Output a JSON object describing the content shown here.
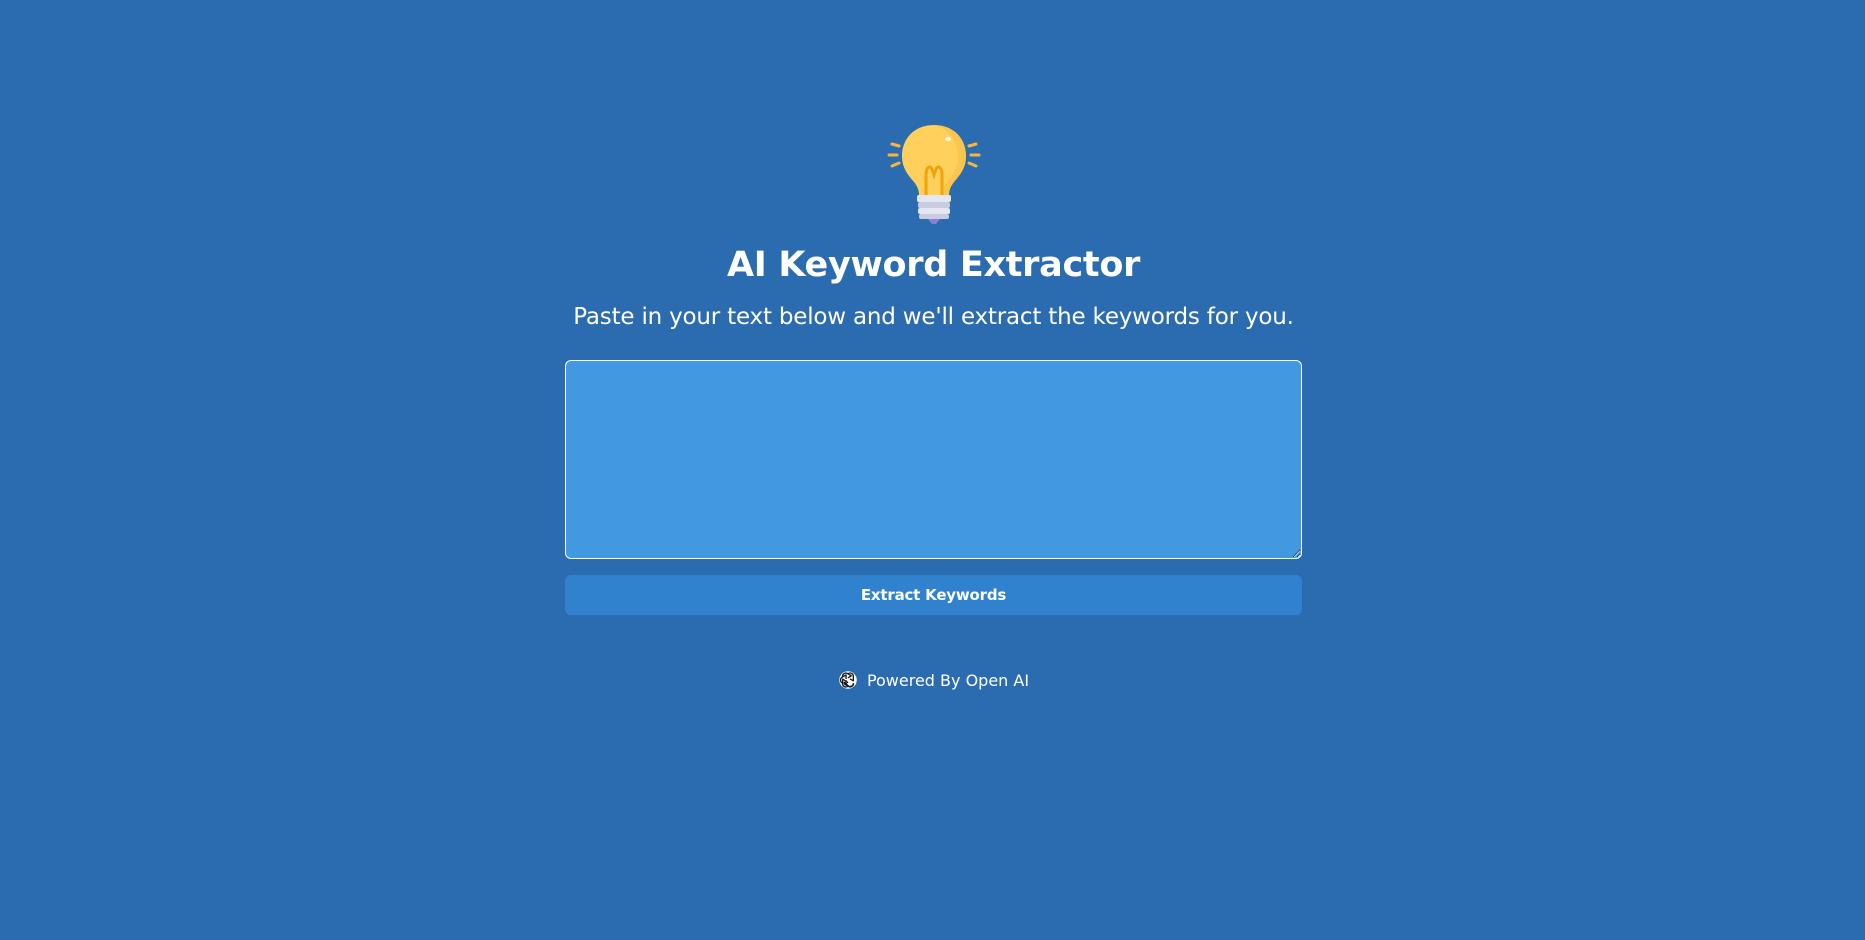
{
  "app": {
    "title": "AI Keyword Extractor",
    "subtitle": "Paste in your text below and we'll extract the keywords for you."
  },
  "hero_icon": "lightbulb-icon",
  "input": {
    "value": "",
    "placeholder": ""
  },
  "actions": {
    "extract_label": "Extract Keywords"
  },
  "footer": {
    "icon": "openai-icon",
    "powered_by": "Powered By Open AI"
  },
  "colors": {
    "background": "#2b6cb0",
    "textarea_bg": "#4299e1",
    "button_bg": "#3182ce",
    "text": "#ffffff",
    "bulb": "#ffd05b"
  }
}
